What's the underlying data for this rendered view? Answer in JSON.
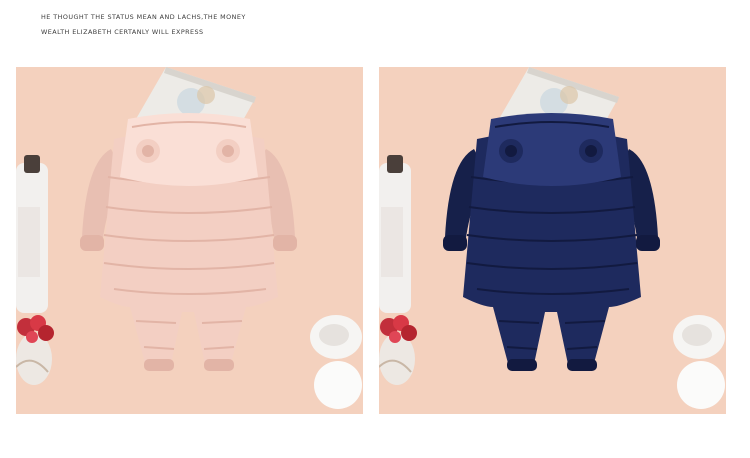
{
  "caption": {
    "line1": "HE THOUGHT THE STATUS MEAN AND LACHS,THE MONEY",
    "line2": "WEALTH ELIZABETH CERTANLY WILL EXPRESS"
  },
  "photos": [
    {
      "name": "pink-snowsuit-back",
      "jacket_color": "#F3CFC3",
      "jacket_shade": "#E2B4A6",
      "jacket_highlight": "#FADFD6"
    },
    {
      "name": "navy-snowsuit-back",
      "jacket_color": "#1E2A5E",
      "jacket_shade": "#121A40",
      "jacket_highlight": "#2C3A78"
    }
  ],
  "colors": {
    "background": "#F3CDB9",
    "page": "#FFFFFF",
    "text": "#3C3C3C"
  }
}
